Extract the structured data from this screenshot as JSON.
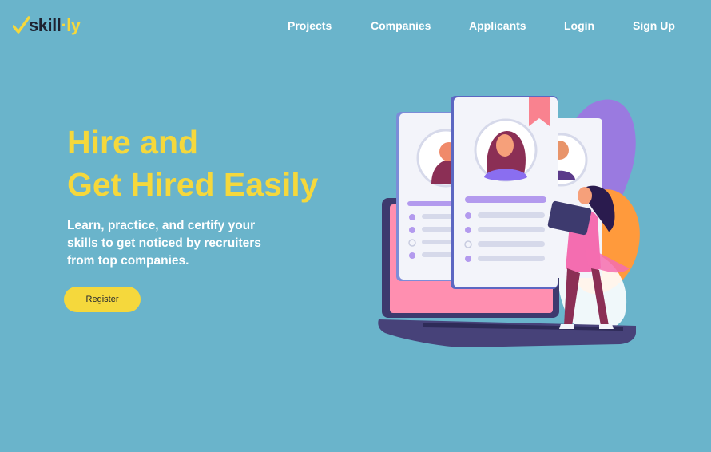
{
  "logo": {
    "part1": "skill",
    "dot": "·",
    "part2": "ly"
  },
  "nav": {
    "items": [
      {
        "label": "Projects"
      },
      {
        "label": "Companies"
      },
      {
        "label": "Applicants"
      },
      {
        "label": "Login"
      },
      {
        "label": "Sign Up"
      }
    ]
  },
  "hero": {
    "title_line1": "Hire and",
    "title_line2": "Get Hired Easily",
    "description_lines": [
      "Learn, practice, and certify your",
      "skills to get noticed by recruiters",
      "from top companies."
    ],
    "register_label": "Register"
  },
  "colors": {
    "background": "#6ab4cb",
    "accent": "#f5d83c",
    "text_light": "#ffffff",
    "text_dark": "#1e2230"
  },
  "icons": {
    "logo": "check-mark-icon",
    "illustration": "recruitment-profiles-illustration"
  }
}
